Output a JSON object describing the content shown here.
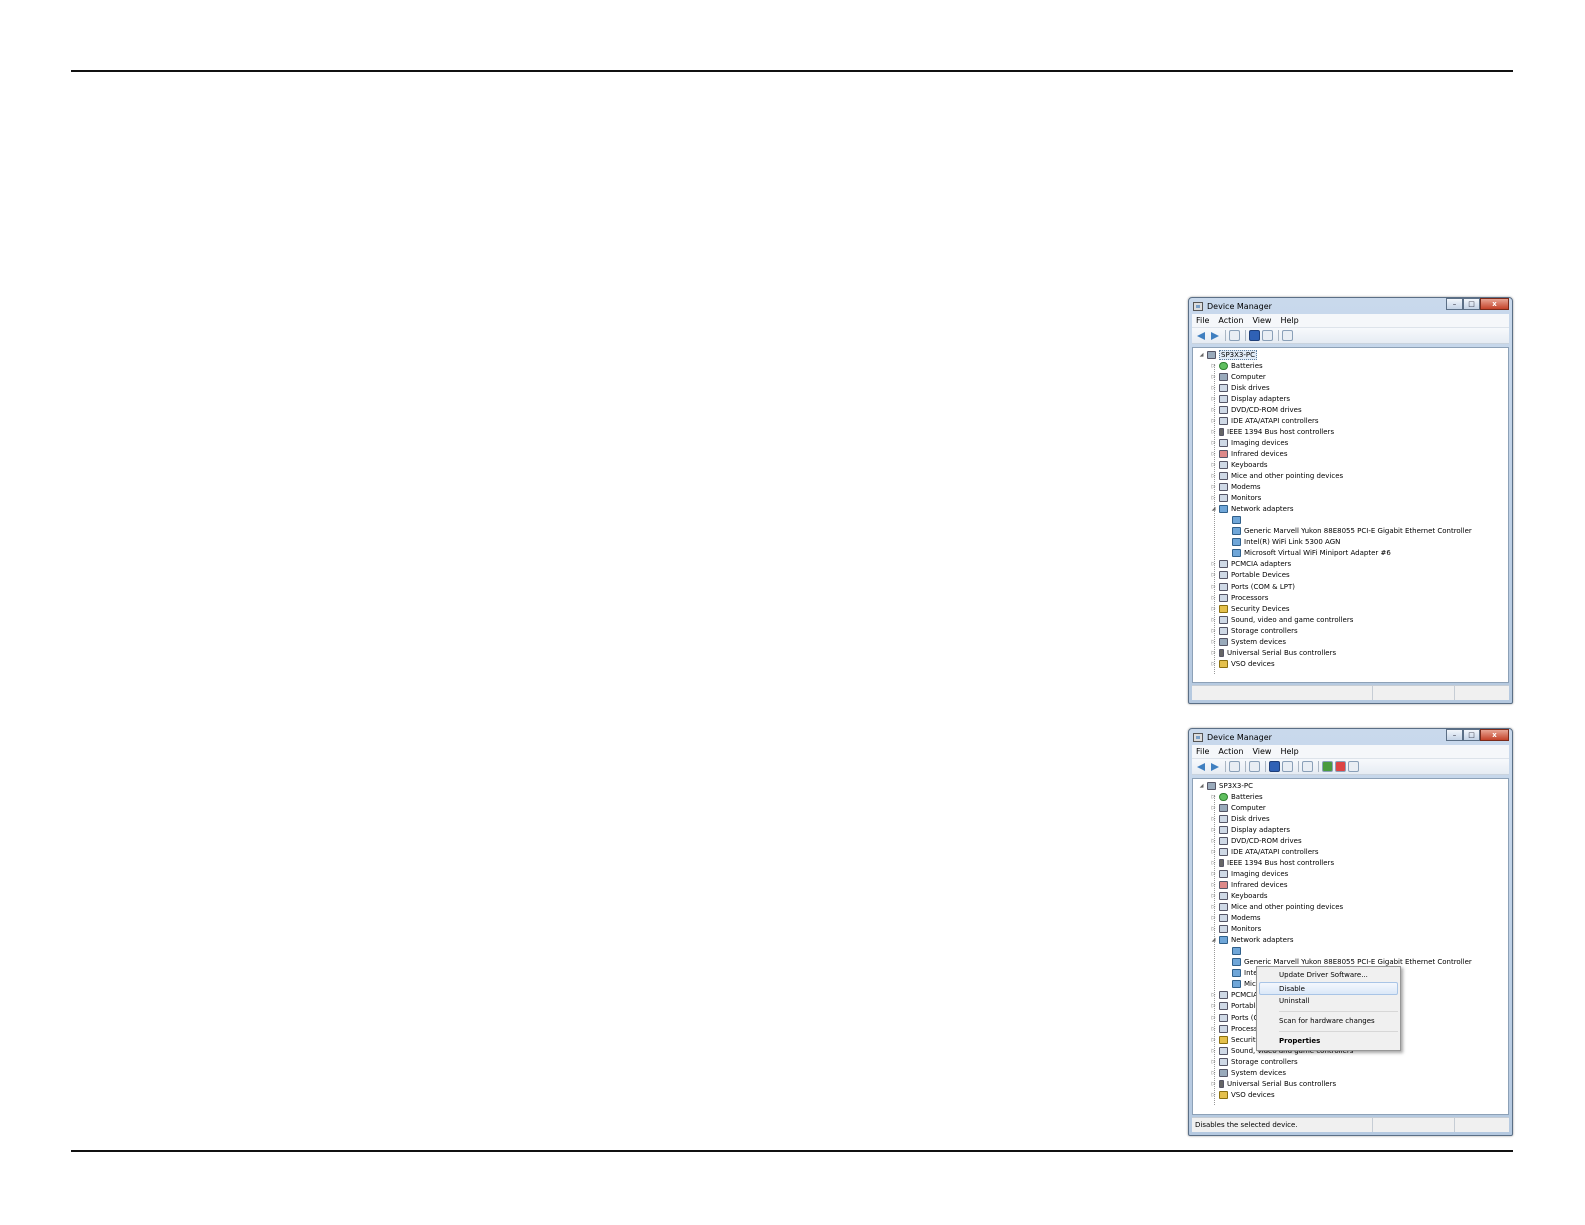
{
  "window1": {
    "title": "Device Manager",
    "controls": {
      "minimize": "–",
      "maximize": "□",
      "close": "x"
    },
    "menu": [
      "File",
      "Action",
      "View",
      "Help"
    ],
    "root": "SP3X3-PC",
    "categories_before": [
      "Batteries",
      "Computer",
      "Disk drives",
      "Display adapters",
      "DVD/CD-ROM drives",
      "IDE ATA/ATAPI controllers",
      "IEEE 1394 Bus host controllers",
      "Imaging devices",
      "Infrared devices",
      "Keyboards",
      "Mice and other pointing devices",
      "Modems",
      "Monitors"
    ],
    "network_label": "Network adapters",
    "network_children": [
      "",
      "Generic Marvell Yukon 88E8055 PCI-E Gigabit Ethernet Controller",
      "Intel(R) WiFi Link 5300 AGN",
      "Microsoft Virtual WiFi Miniport Adapter #6"
    ],
    "categories_after": [
      "PCMCIA adapters",
      "Portable Devices",
      "Ports (COM & LPT)",
      "Processors",
      "Security Devices",
      "Sound, video and game controllers",
      "Storage controllers",
      "System devices",
      "Universal Serial Bus controllers",
      "VSO devices"
    ],
    "status": ""
  },
  "window2": {
    "title": "Device Manager",
    "controls": {
      "minimize": "–",
      "maximize": "□",
      "close": "x"
    },
    "menu": [
      "File",
      "Action",
      "View",
      "Help"
    ],
    "root": "SP3X3-PC",
    "categories_before": [
      "Batteries",
      "Computer",
      "Disk drives",
      "Display adapters",
      "DVD/CD-ROM drives",
      "IDE ATA/ATAPI controllers",
      "IEEE 1394 Bus host controllers",
      "Imaging devices",
      "Infrared devices",
      "Keyboards",
      "Mice and other pointing devices",
      "Modems",
      "Monitors"
    ],
    "network_label": "Network adapters",
    "network_children": [
      "",
      "Generic Marvell Yukon 88E8055 PCI-E Gigabit Ethernet Controller",
      "Intel",
      "Micr"
    ],
    "categories_after": [
      "PCMCIA",
      "Portable",
      "Ports (C",
      "Process",
      "Security",
      "Sound, video and game controllers",
      "Storage controllers",
      "System devices",
      "Universal Serial Bus controllers",
      "VSO devices"
    ],
    "status": "Disables the selected device.",
    "context_menu": {
      "update": "Update Driver Software...",
      "disable": "Disable",
      "uninstall": "Uninstall",
      "scan": "Scan for hardware changes",
      "properties": "Properties"
    }
  }
}
